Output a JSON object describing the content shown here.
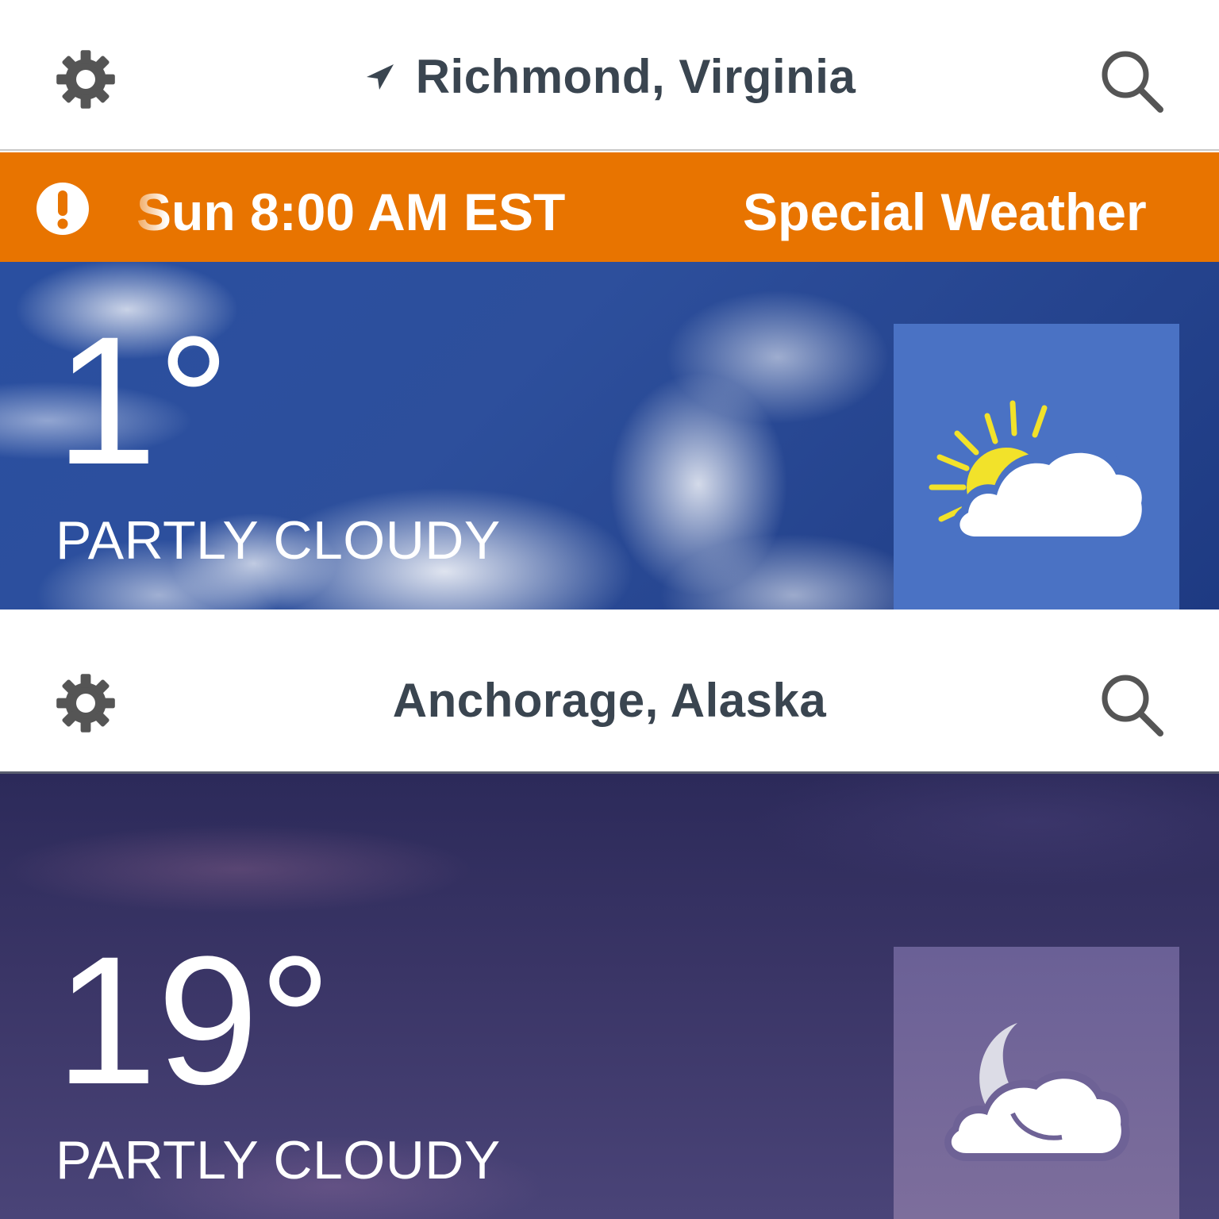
{
  "panels": [
    {
      "city": "Richmond, Virginia",
      "has_location_arrow": true,
      "alert": {
        "time": "Sun 8:00 AM EST",
        "message": "Special Weather"
      },
      "temperature": "1°",
      "condition": "PARTLY CLOUDY",
      "icon": "partly-cloudy-day-icon"
    },
    {
      "city": "Anchorage, Alaska",
      "has_location_arrow": false,
      "temperature": "19°",
      "condition": "PARTLY CLOUDY",
      "icon": "partly-cloudy-night-icon"
    }
  ],
  "icons": {
    "settings": "gear-icon",
    "search": "search-icon",
    "location": "location-arrow-icon",
    "alert": "exclamation-icon"
  },
  "colors": {
    "alert_bg": "#e87400",
    "header_text": "#3a4550",
    "icon_gray": "#555555",
    "day_tile": "#4a72c4",
    "night_tile": "#6e6296",
    "sun": "#f2e22a"
  }
}
